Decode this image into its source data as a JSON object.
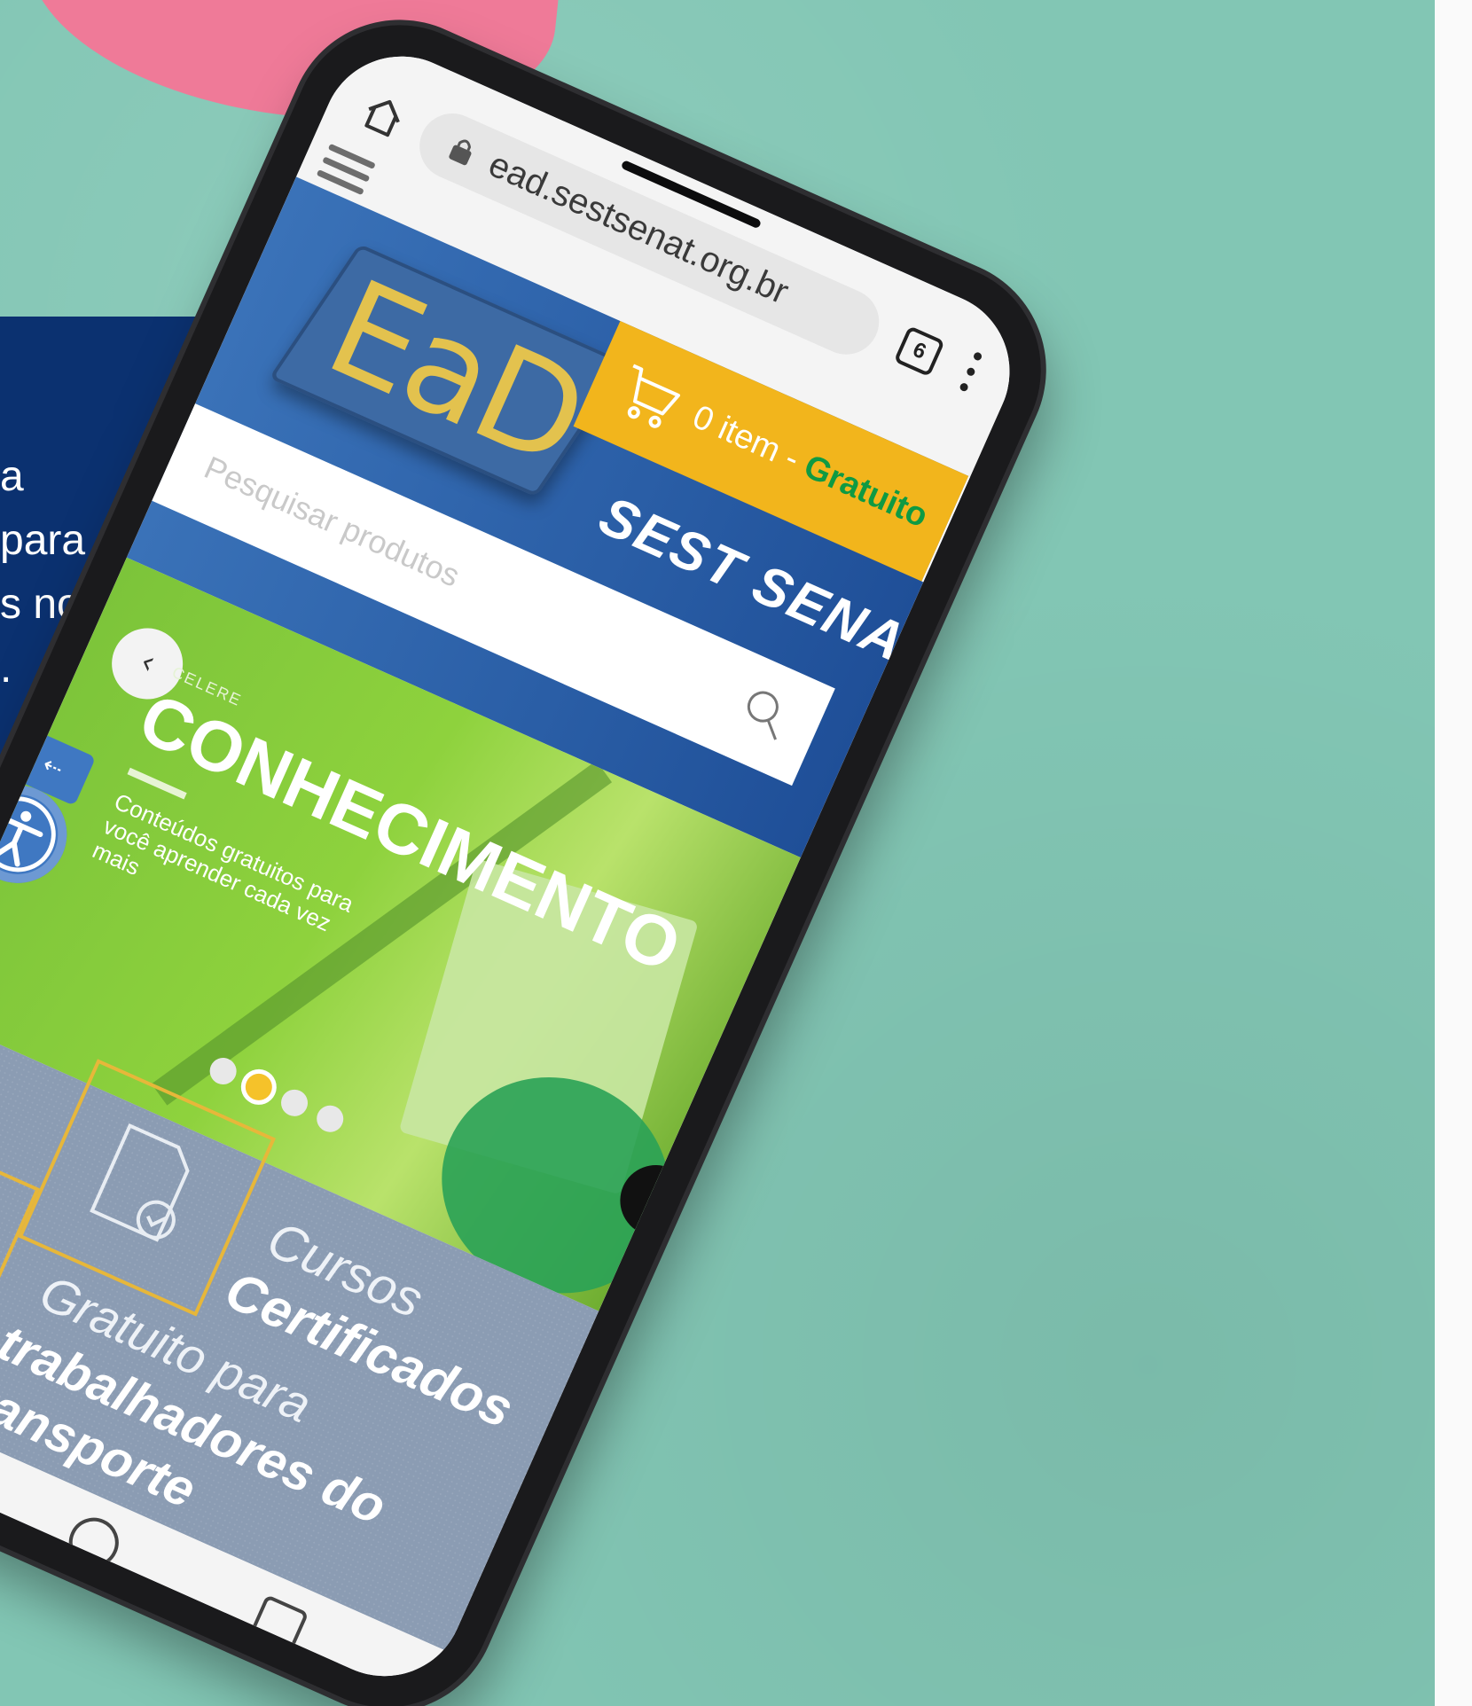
{
  "background": {
    "teal": "#82c6b4",
    "pink_bubble": "#ef7a98",
    "navy_card": "#0b3170"
  },
  "navy_card": {
    "lines": [
      "a",
      " para",
      "s no",
      "."
    ]
  },
  "browser": {
    "url": "ead.sestsenat.org.br",
    "tab_count": "6"
  },
  "site": {
    "logo_text": "EaD",
    "cart_text": "0 item - ",
    "cart_free": "Gratuito",
    "brand": "SEST SENAT",
    "search_placeholder": "Pesquisar produtos",
    "accent_yellow": "#f2b51c",
    "accent_blue": "#2a5ea6"
  },
  "hero": {
    "kicker": "CELERE",
    "title": "CONHECIMENTO",
    "subtitle": "Conteúdos gratuitos para você aprender cada vez mais",
    "prev_label": "‹",
    "next_label": "›",
    "access_arrow": "⇠",
    "slide_count": 4,
    "active_slide": 2
  },
  "features": {
    "item1_light": "Cursos",
    "item1_bold": "Certificados",
    "item2_light": "Gratuito para",
    "item2_bold_1": "trabalhadores do",
    "item2_bold_2": "transporte"
  }
}
